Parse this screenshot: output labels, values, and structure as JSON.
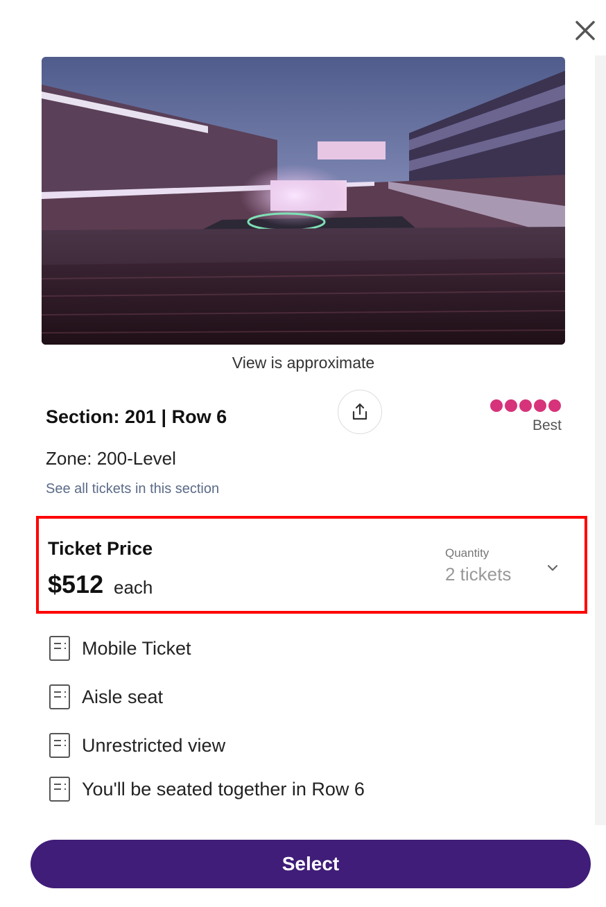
{
  "close": {
    "icon": "close-icon"
  },
  "seat_view": {
    "caption": "View is approximate"
  },
  "listing": {
    "section_row": "Section: 201 | Row 6",
    "zone": "Zone: 200-Level",
    "see_all_link": "See all tickets in this section",
    "share_icon": "share-icon"
  },
  "rating": {
    "label": "Best",
    "filled": 5,
    "total": 5,
    "color": "#d6337a"
  },
  "price": {
    "label": "Ticket Price",
    "amount": "$512",
    "unit": "each",
    "quantity_label": "Quantity",
    "quantity_value": "2 tickets"
  },
  "features": [
    {
      "icon": "ticket-doc-icon",
      "label": "Mobile Ticket"
    },
    {
      "icon": "ticket-doc-icon",
      "label": "Aisle seat"
    },
    {
      "icon": "ticket-doc-icon",
      "label": "Unrestricted view"
    },
    {
      "icon": "ticket-doc-icon",
      "label": "You'll be seated together in Row 6"
    }
  ],
  "colors": {
    "primary": "#3f1d78",
    "highlight_border": "#ff0000",
    "rating": "#d6337a"
  },
  "select_button": {
    "label": "Select"
  }
}
